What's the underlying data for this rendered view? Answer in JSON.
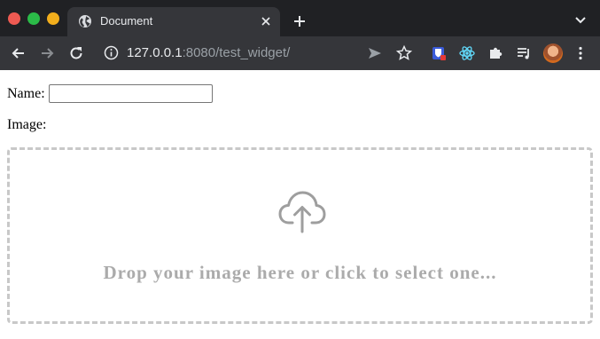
{
  "browser": {
    "tab": {
      "title": "Document"
    },
    "address_bar": {
      "host": "127.0.0.1",
      "port_path": ":8080/test_widget/"
    }
  },
  "page": {
    "name_field": {
      "label": "Name:",
      "value": ""
    },
    "image_field": {
      "label": "Image:",
      "dropzone_text": "Drop your image here or click to select one..."
    }
  },
  "icons": {
    "tab_favicon": "globe-icon",
    "dropzone": "cloud-upload-icon"
  },
  "colors": {
    "chrome_dark": "#202124",
    "toolbar": "#35363a",
    "dropzone_border": "#c8c8c8",
    "dropzone_text": "#ababab"
  }
}
